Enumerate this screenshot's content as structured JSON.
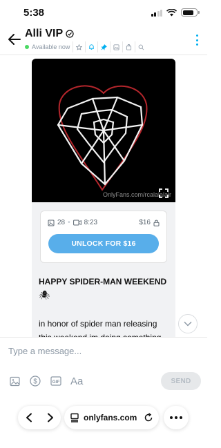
{
  "status_bar": {
    "time": "5:38"
  },
  "header": {
    "title": "Alli VIP",
    "status_text": "Available now",
    "icons": [
      "star-icon",
      "bell-icon",
      "pin-icon",
      "image-icon",
      "shop-icon",
      "search-icon"
    ]
  },
  "post": {
    "watermark": "OnlyFans.com/rcalalalalr",
    "media": {
      "photo_count": "28",
      "video_length": "8:23"
    },
    "price": "$16",
    "unlock_label": "UNLOCK FOR $16",
    "title": "HAPPY SPIDER-MAN WEEKEND",
    "emoji": "🕷",
    "body": "in honor of spider man releasing this weekend im doing something"
  },
  "composer": {
    "placeholder": "Type a message...",
    "format_label": "Aa",
    "send_label": "SEND"
  },
  "browser": {
    "url": "onlyfans.com"
  },
  "colors": {
    "accent": "#00aff0",
    "unlock_button": "#58aeea",
    "online": "#4cd964"
  }
}
